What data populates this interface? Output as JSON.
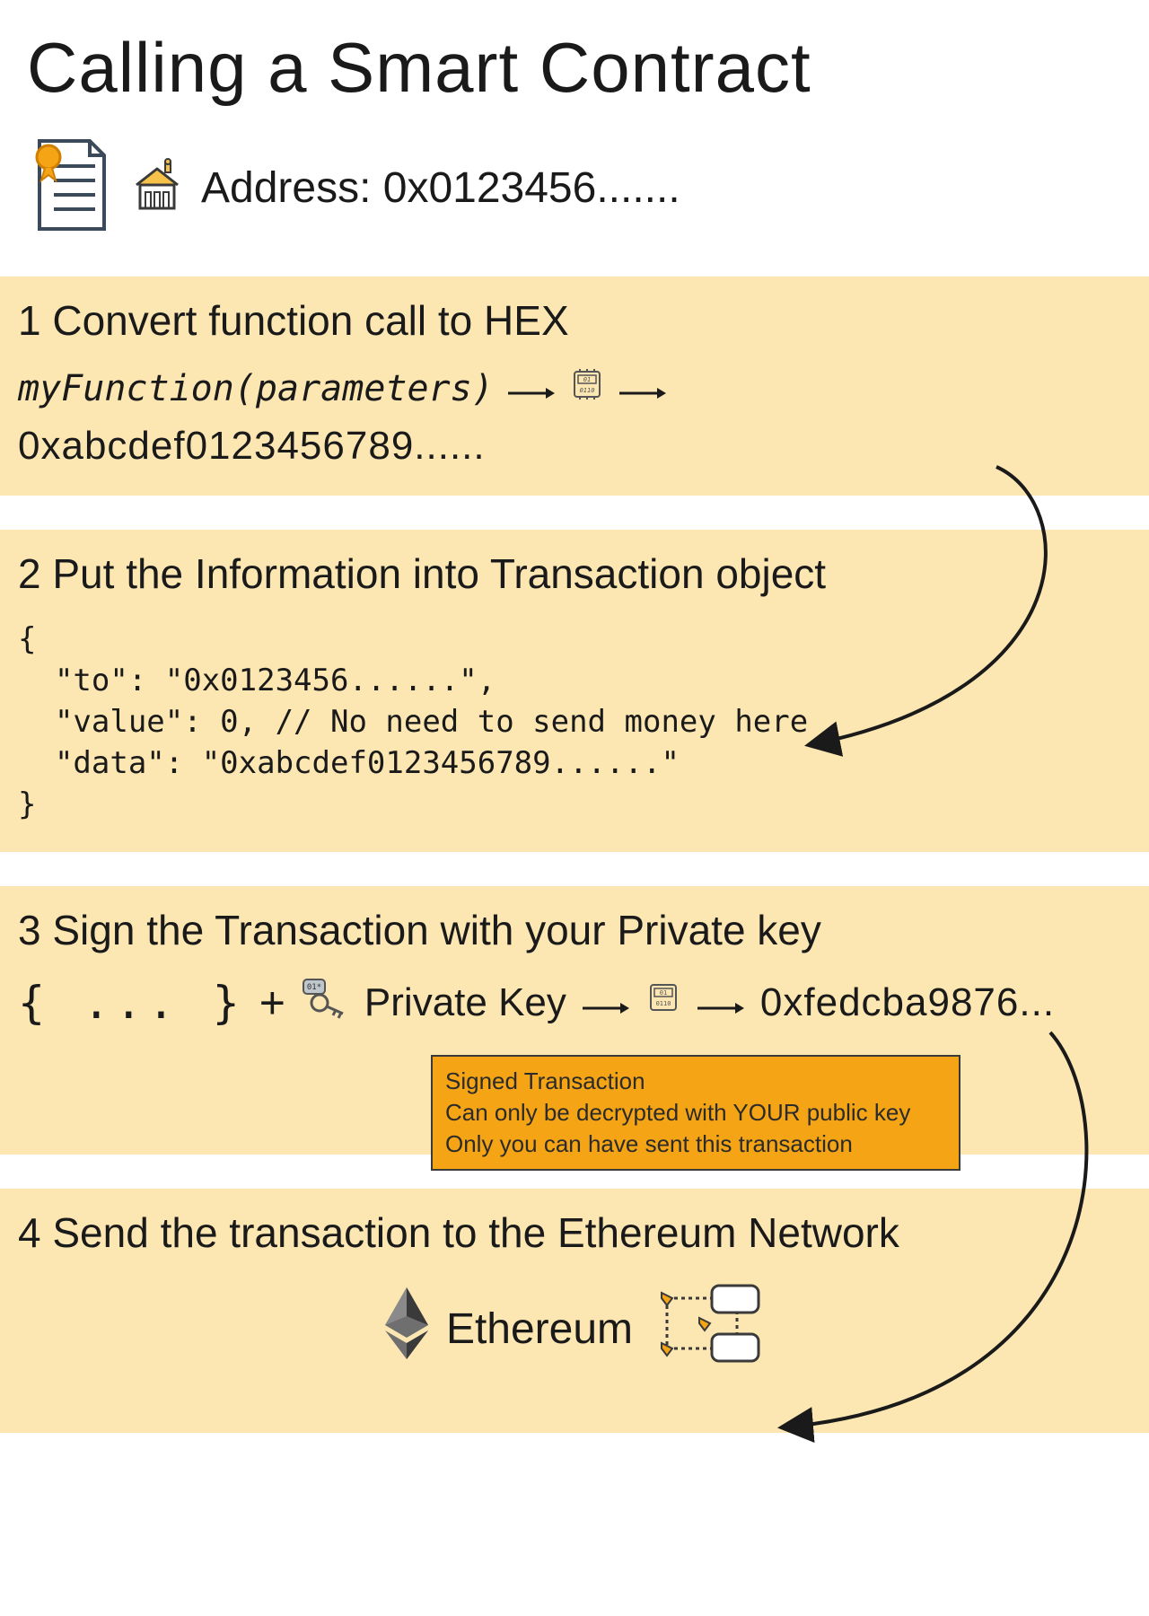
{
  "title": "Calling a Smart Contract",
  "address_label": "Address: 0x0123456.......",
  "step1": {
    "heading": "1 Convert function call to HEX",
    "fn": "myFunction(parameters)",
    "hex": "0xabcdef0123456789......"
  },
  "step2": {
    "heading": "2 Put the Information into Transaction object",
    "code": "{\n  \"to\": \"0x0123456......\",\n  \"value\": 0, // No need to send money here\n  \"data\": \"0xabcdef0123456789......\"\n}"
  },
  "step3": {
    "heading": "3 Sign the Transaction with your Private key",
    "braces": "{ ... }",
    "plus": "+",
    "pk_label": "Private Key",
    "hex": "0xfedcba9876...",
    "note_l1": "Signed Transaction",
    "note_l2": "Can only be decrypted with YOUR public key",
    "note_l3": "Only you can have sent this transaction"
  },
  "step4": {
    "heading": "4 Send the transaction to the Ethereum Network",
    "eth": "Ethereum"
  }
}
